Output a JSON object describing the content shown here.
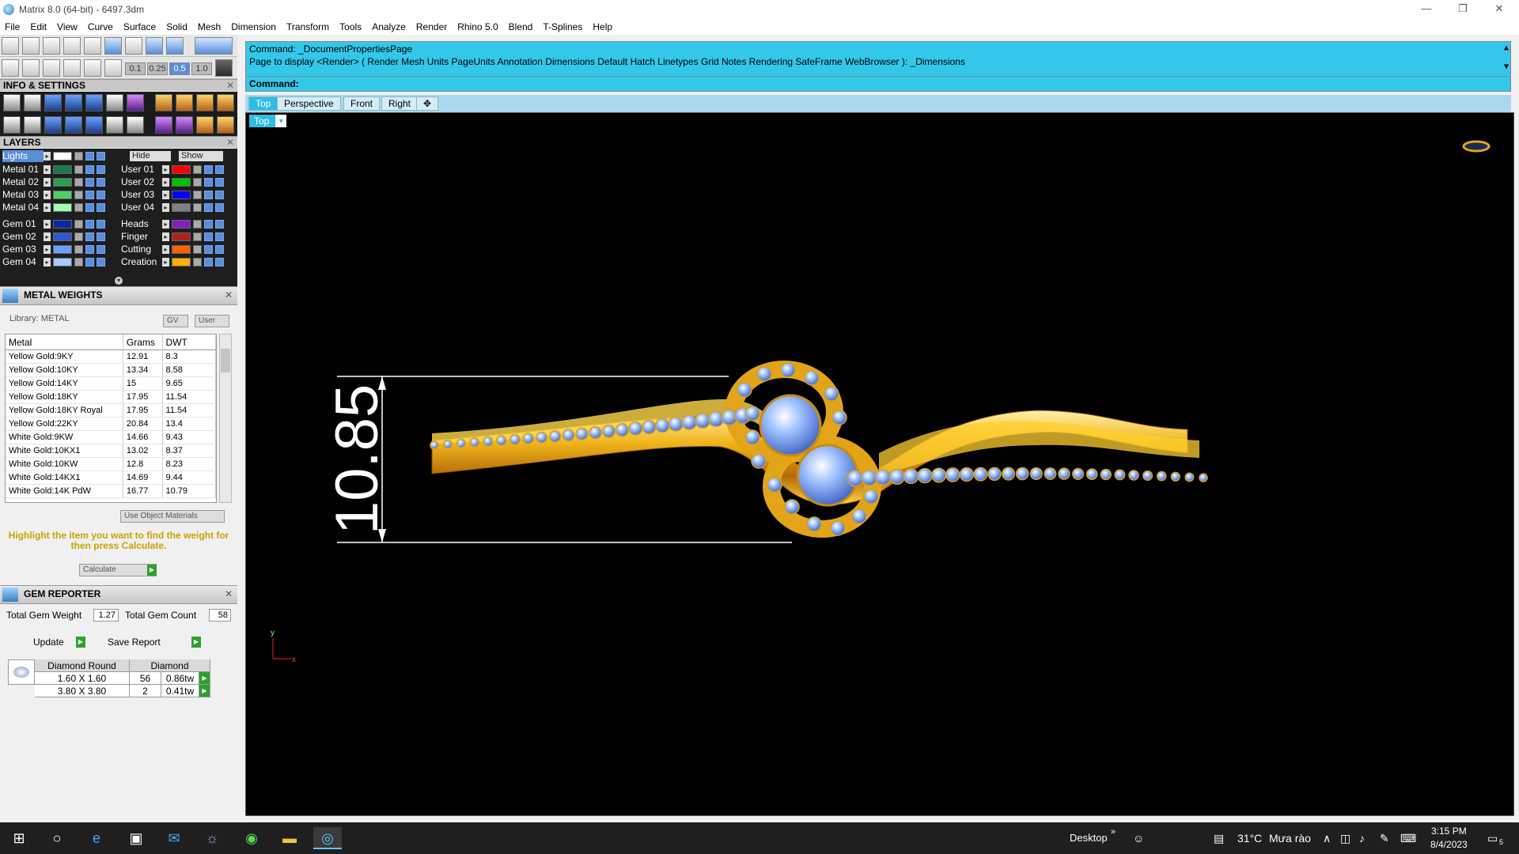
{
  "window": {
    "title": "Matrix 8.0 (64-bit) - 6497.3dm",
    "min": "—",
    "max": "❐",
    "close": "✕"
  },
  "menu": [
    "File",
    "Edit",
    "View",
    "Curve",
    "Surface",
    "Solid",
    "Mesh",
    "Dimension",
    "Transform",
    "Tools",
    "Analyze",
    "Render",
    "Rhino 5.0",
    "Blend",
    "T-Splines",
    "Help"
  ],
  "toolbar": {
    "snap_values": [
      "0.1",
      "0.25",
      "0.5",
      "1.0"
    ]
  },
  "info_settings": {
    "title": "INFO & SETTINGS",
    "close": "✕"
  },
  "layers": {
    "title": "LAYERS",
    "close": "✕",
    "hide_label": "Hide",
    "show_label": "Show",
    "selected": "Lights",
    "left": [
      {
        "name": "Metal 01",
        "color": "#1a7a4a"
      },
      {
        "name": "Metal 02",
        "color": "#2aa050"
      },
      {
        "name": "Metal 03",
        "color": "#50d060"
      },
      {
        "name": "Metal 04",
        "color": "#a0ffb0"
      },
      {
        "name": "Gem 01",
        "color": "#0a2aa0"
      },
      {
        "name": "Gem 02",
        "color": "#2a5ad0"
      },
      {
        "name": "Gem 03",
        "color": "#6aa0ff"
      },
      {
        "name": "Gem 04",
        "color": "#a8c8ff"
      }
    ],
    "right": [
      {
        "name": "User 01",
        "color": "#ff0000"
      },
      {
        "name": "User 02",
        "color": "#00c000"
      },
      {
        "name": "User 03",
        "color": "#0000ff"
      },
      {
        "name": "User 04",
        "color": "#808080"
      },
      {
        "name": "Heads",
        "color": "#8020c0"
      },
      {
        "name": "Finger",
        "color": "#b02020"
      },
      {
        "name": "Cutting",
        "color": "#ff6000"
      },
      {
        "name": "Creation",
        "color": "#ffb000"
      }
    ]
  },
  "metal_weights": {
    "title": "METAL WEIGHTS",
    "library": "Library: METAL",
    "gv_label": "GV",
    "user_label": "User",
    "columns": [
      "Metal",
      "Grams",
      "DWT"
    ],
    "rows": [
      [
        "Yellow Gold:9KY",
        "12.91",
        "8.3"
      ],
      [
        "Yellow Gold:10KY",
        "13.34",
        "8.58"
      ],
      [
        "Yellow Gold:14KY",
        "15",
        "9.65"
      ],
      [
        "Yellow Gold:18KY",
        "17.95",
        "11.54"
      ],
      [
        "Yellow Gold:18KY Royal",
        "17.95",
        "11.54"
      ],
      [
        "Yellow Gold:22KY",
        "20.84",
        "13.4"
      ],
      [
        "White Gold:9KW",
        "14.66",
        "9.43"
      ],
      [
        "White Gold:10KX1",
        "13.02",
        "8.37"
      ],
      [
        "White Gold:10KW",
        "12.8",
        "8.23"
      ],
      [
        "White Gold:14KX1",
        "14.69",
        "9.44"
      ],
      [
        "White Gold:14K PdW",
        "16.77",
        "10.79"
      ]
    ],
    "use_object_materials": "Use Object Materials",
    "hint": "Highlight the item you want to find the weight for then press Calculate.",
    "calculate": "Calculate"
  },
  "gem_reporter": {
    "title": "GEM REPORTER",
    "total_weight_label": "Total Gem Weight",
    "total_weight": "1.27",
    "total_count_label": "Total Gem Count",
    "total_count": "58",
    "update": "Update",
    "save_report": "Save Report",
    "header": [
      "Diamond Round",
      "Diamond"
    ],
    "rows": [
      [
        "1.60 X 1.60",
        "56",
        "0.86tw"
      ],
      [
        "3.80 X 3.80",
        "2",
        "0.41tw"
      ]
    ]
  },
  "command": {
    "line1": "Command: _DocumentPropertiesPage",
    "line2": "Page to display <Render> ( Render  Mesh  Units  PageUnits  Annotation  Dimensions  Default  Hatch  Linetypes  Grid  Notes  Rendering  SafeFrame  WebBrowser ): _Dimensions",
    "prompt": "Command:"
  },
  "viewport": {
    "tabs": [
      "Top",
      "Perspective",
      "Front",
      "Right",
      "✥"
    ],
    "active_tab": "Top",
    "label": "Top",
    "dimension_text": "10.85",
    "axis_y": "y",
    "axis_x": "x"
  },
  "taskbar": {
    "desktop": "Desktop",
    "temperature": "31°C",
    "weather": "Mưa rào",
    "time": "3:15 PM",
    "date": "8/4/2023",
    "notifications": "5"
  }
}
